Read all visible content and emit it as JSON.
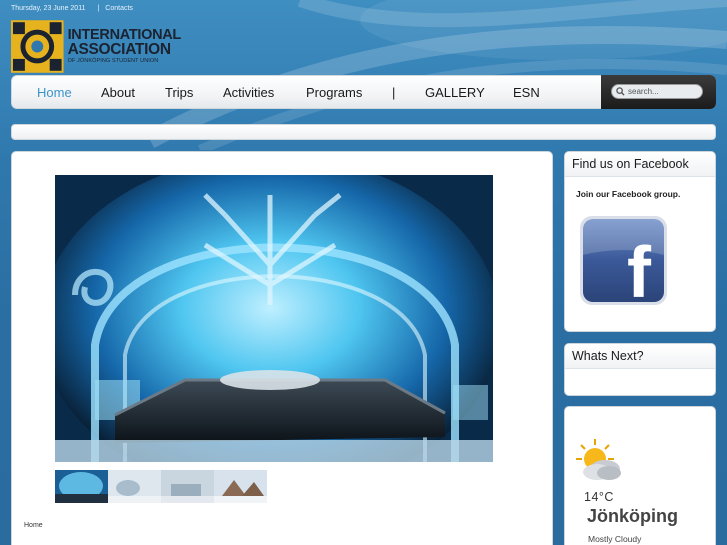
{
  "top_bar": {
    "date": "Thursday, 23 June 2011",
    "separator": "|",
    "contacts": "Contacts"
  },
  "logo": {
    "line1": "INTERNATIONAL",
    "line2": "ASSOCIATION",
    "line3": "OF JÖNKÖPING STUDENT UNION"
  },
  "nav": {
    "items": [
      {
        "label": "Home"
      },
      {
        "label": "About"
      },
      {
        "label": "Trips"
      },
      {
        "label": "Activities"
      },
      {
        "label": "Programs"
      },
      {
        "label": "|"
      },
      {
        "label": "GALLERY"
      },
      {
        "label": "ESN"
      }
    ],
    "search_placeholder": "search..."
  },
  "breadcrumb": "Home",
  "sidebar": {
    "facebook": {
      "title": "Find us on Facebook",
      "text": "Join our Facebook group.",
      "logo_letter": "f"
    },
    "whats_next": {
      "title": "Whats Next?"
    },
    "weather": {
      "temp": "14°C",
      "city": "Jönköping",
      "condition": "Mostly Cloudy"
    }
  },
  "colors": {
    "accent": "#3c93c9",
    "background": "#2f78ad",
    "facebook_blue": "#3b5998",
    "logo_gold": "#e6b21e"
  },
  "icons": {
    "search": "magnifier-icon",
    "weather": "partly-cloudy-icon",
    "facebook": "facebook-logo-icon"
  }
}
